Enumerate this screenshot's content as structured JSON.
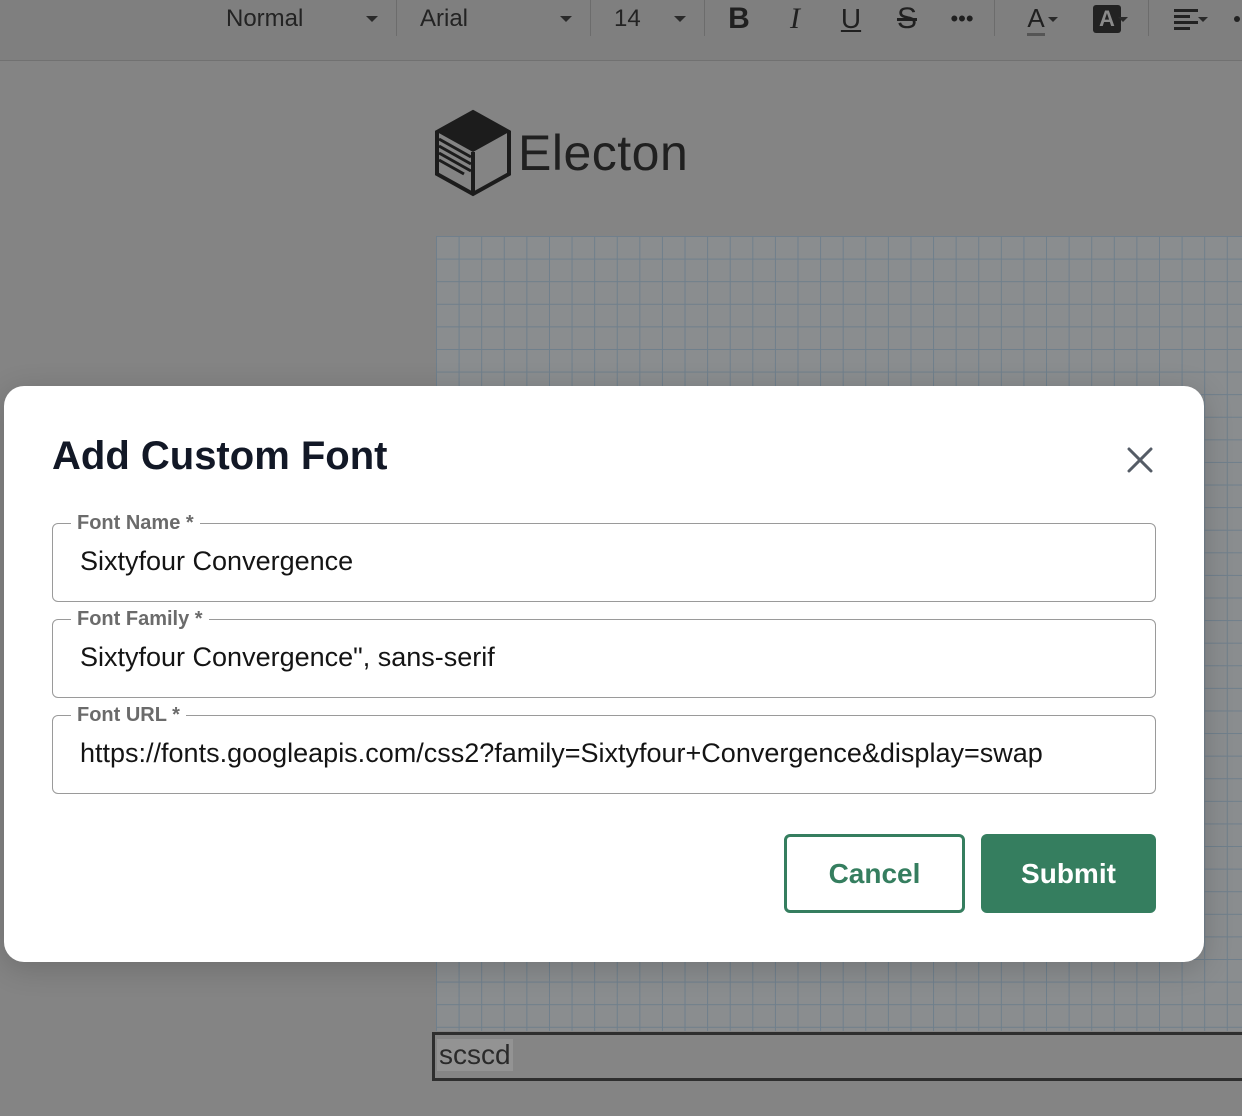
{
  "toolbar": {
    "style_select": "Normal",
    "font_select": "Arial",
    "size_select": "14",
    "bold_label": "B",
    "italic_label": "I",
    "underline_label": "U",
    "strike_label": "S",
    "more_label": "•••",
    "text_color_label": "A",
    "highlight_label": "A"
  },
  "document": {
    "logo_text": "Electon",
    "input_value": "scscd"
  },
  "modal": {
    "title": "Add Custom Font",
    "fields": [
      {
        "label": "Font Name *",
        "value": "Sixtyfour Convergence"
      },
      {
        "label": "Font Family *",
        "value": "Sixtyfour Convergence\", sans-serif"
      },
      {
        "label": "Font URL *",
        "value": "https://fonts.googleapis.com/css2?family=Sixtyfour+Convergence&display=swap"
      }
    ],
    "cancel_label": "Cancel",
    "submit_label": "Submit"
  },
  "colors": {
    "accent": "#357e5f",
    "overlay": "#848484",
    "title": "#121826"
  },
  "icons": {
    "close": "close-icon",
    "logo": "cube-logo-icon",
    "align": "align-left-icon"
  }
}
